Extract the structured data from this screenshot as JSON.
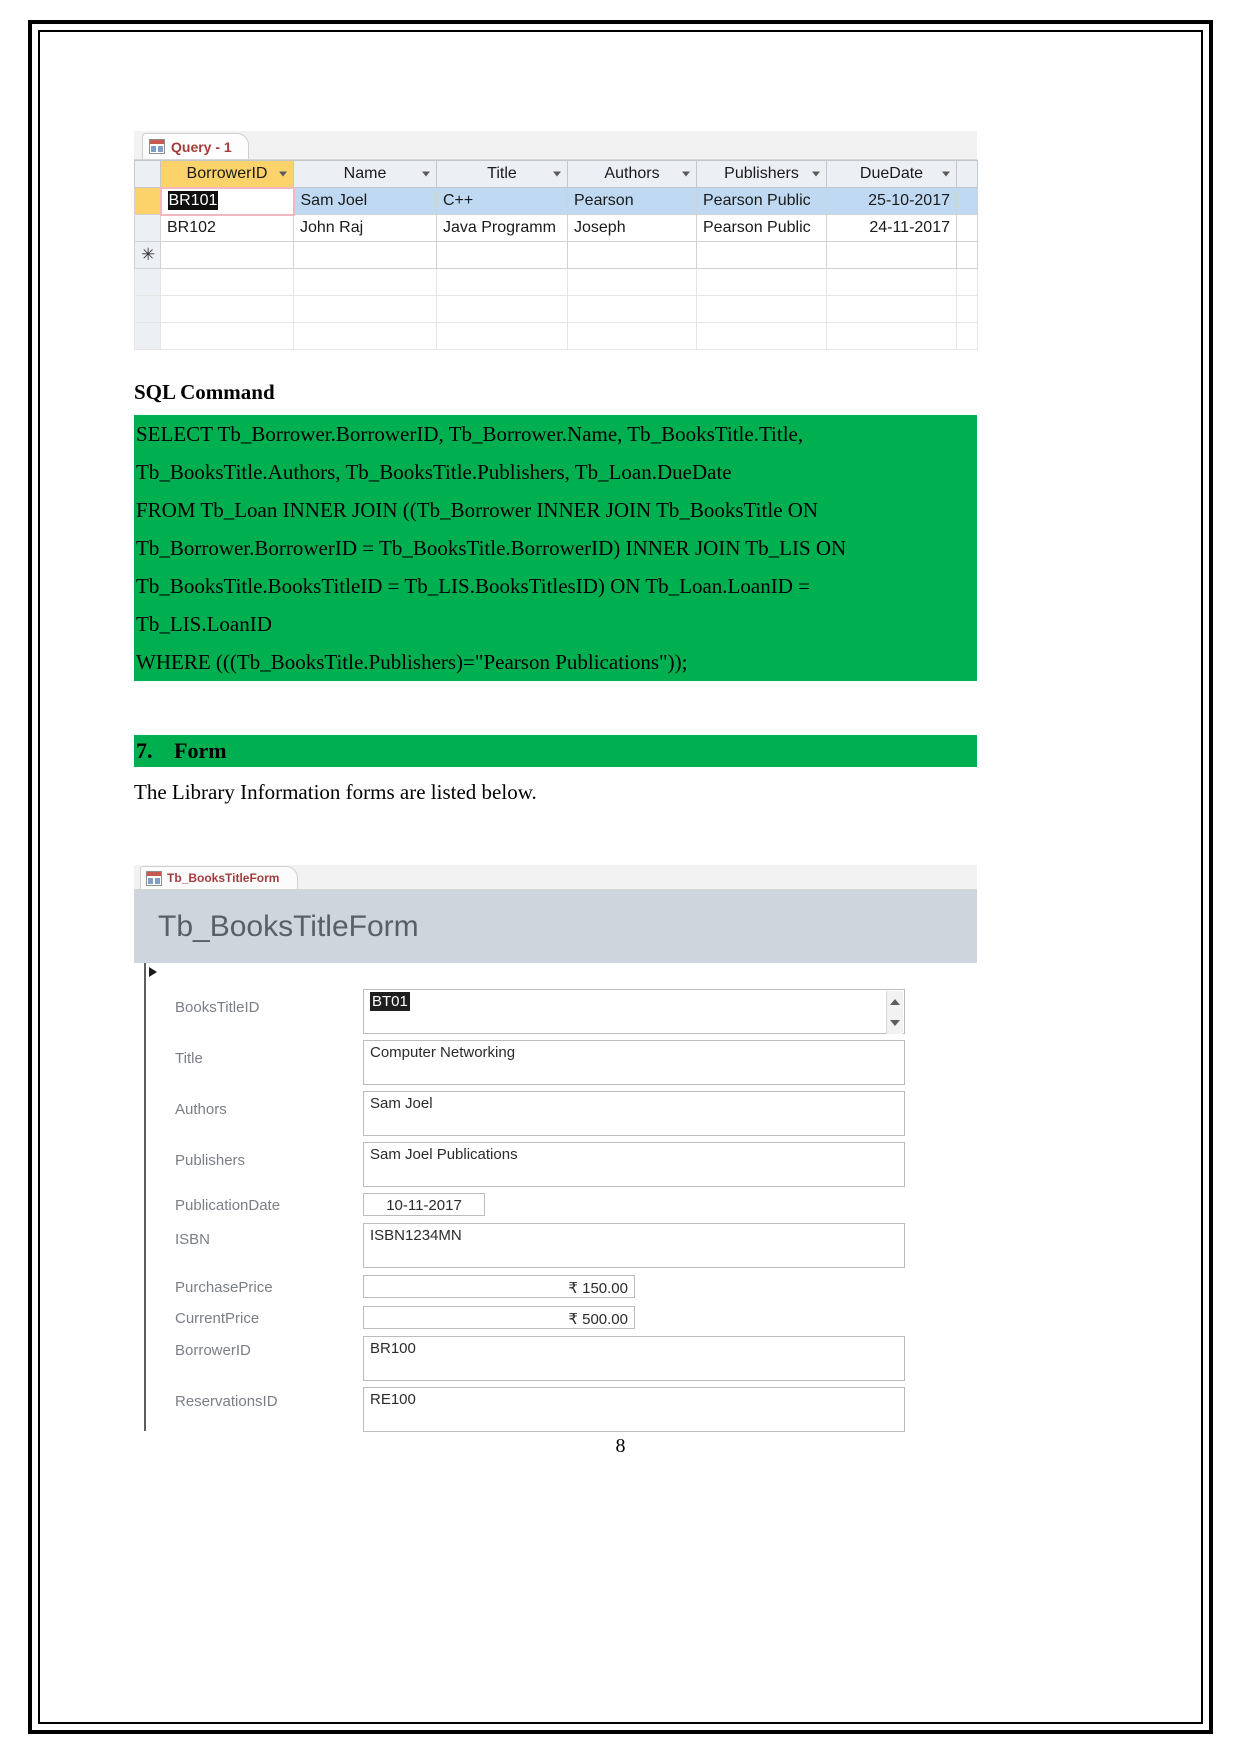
{
  "document": {
    "page_number": "8",
    "sql_command_heading": "SQL Command",
    "form_intro_text": "The Library Information forms are listed below.",
    "accent_green": "#00b050",
    "section": {
      "number": "7.",
      "title": "Form"
    }
  },
  "query_datasheet": {
    "tab_label": "Query - 1",
    "tab_icon": "query-datasheet-icon",
    "columns": [
      {
        "label": "BorrowerID",
        "dropdown_icon": "chevron-down-icon"
      },
      {
        "label": "Name",
        "dropdown_icon": "chevron-down-icon"
      },
      {
        "label": "Title",
        "dropdown_icon": "chevron-down-icon"
      },
      {
        "label": "Authors",
        "dropdown_icon": "chevron-down-icon"
      },
      {
        "label": "Publishers",
        "dropdown_icon": "chevron-down-icon"
      },
      {
        "label": "DueDate",
        "dropdown_icon": "chevron-down-icon"
      }
    ],
    "rows": [
      {
        "BorrowerID": "BR101",
        "Name": "Sam Joel",
        "Title": "C++",
        "Authors": "Pearson",
        "Publishers": "Pearson Public",
        "DueDate": "25-10-2017"
      },
      {
        "BorrowerID": "BR102",
        "Name": "John Raj",
        "Title": "Java Programm",
        "Authors": "Joseph",
        "Publishers": "Pearson Public",
        "DueDate": "24-11-2017"
      }
    ],
    "new_record_marker": "✳"
  },
  "sql": {
    "lines": [
      "SELECT Tb_Borrower.BorrowerID, Tb_Borrower.Name, Tb_BooksTitle.Title,",
      "Tb_BooksTitle.Authors, Tb_BooksTitle.Publishers, Tb_Loan.DueDate",
      "FROM Tb_Loan INNER JOIN ((Tb_Borrower INNER JOIN Tb_BooksTitle ON",
      "Tb_Borrower.BorrowerID = Tb_BooksTitle.BorrowerID) INNER JOIN Tb_LIS ON",
      "Tb_BooksTitle.BooksTitleID = Tb_LIS.BooksTitlesID) ON Tb_Loan.LoanID =",
      "Tb_LIS.LoanID",
      "WHERE (((Tb_BooksTitle.Publishers)=\"Pearson Publications\"));"
    ]
  },
  "access_form": {
    "tab_label": "Tb_BooksTitleForm",
    "tab_icon": "form-view-icon",
    "header_title": "Tb_BooksTitleForm",
    "record_selector_icon": "record-arrow-icon",
    "fields": [
      {
        "label": "BooksTitleID",
        "value": "BT01",
        "selected": true,
        "style": "tall",
        "spinner": true
      },
      {
        "label": "Title",
        "value": "Computer Networking",
        "selected": false,
        "style": "tall",
        "spinner": false
      },
      {
        "label": "Authors",
        "value": "Sam Joel",
        "selected": false,
        "style": "tall",
        "spinner": false
      },
      {
        "label": "Publishers",
        "value": "Sam Joel Publications",
        "selected": false,
        "style": "tall",
        "spinner": false
      },
      {
        "label": "PublicationDate",
        "value": "10-11-2017",
        "selected": false,
        "style": "date",
        "spinner": false
      },
      {
        "label": "ISBN",
        "value": "ISBN1234MN",
        "selected": false,
        "style": "tall",
        "spinner": false
      },
      {
        "label": "PurchasePrice",
        "value": "₹ 150.00",
        "selected": false,
        "style": "numeric",
        "spinner": false
      },
      {
        "label": "CurrentPrice",
        "value": "₹ 500.00",
        "selected": false,
        "style": "numeric",
        "spinner": false
      },
      {
        "label": "BorrowerID",
        "value": "BR100",
        "selected": false,
        "style": "tall",
        "spinner": false
      },
      {
        "label": "ReservationsID",
        "value": "RE100",
        "selected": false,
        "style": "tall",
        "spinner": false
      }
    ]
  }
}
